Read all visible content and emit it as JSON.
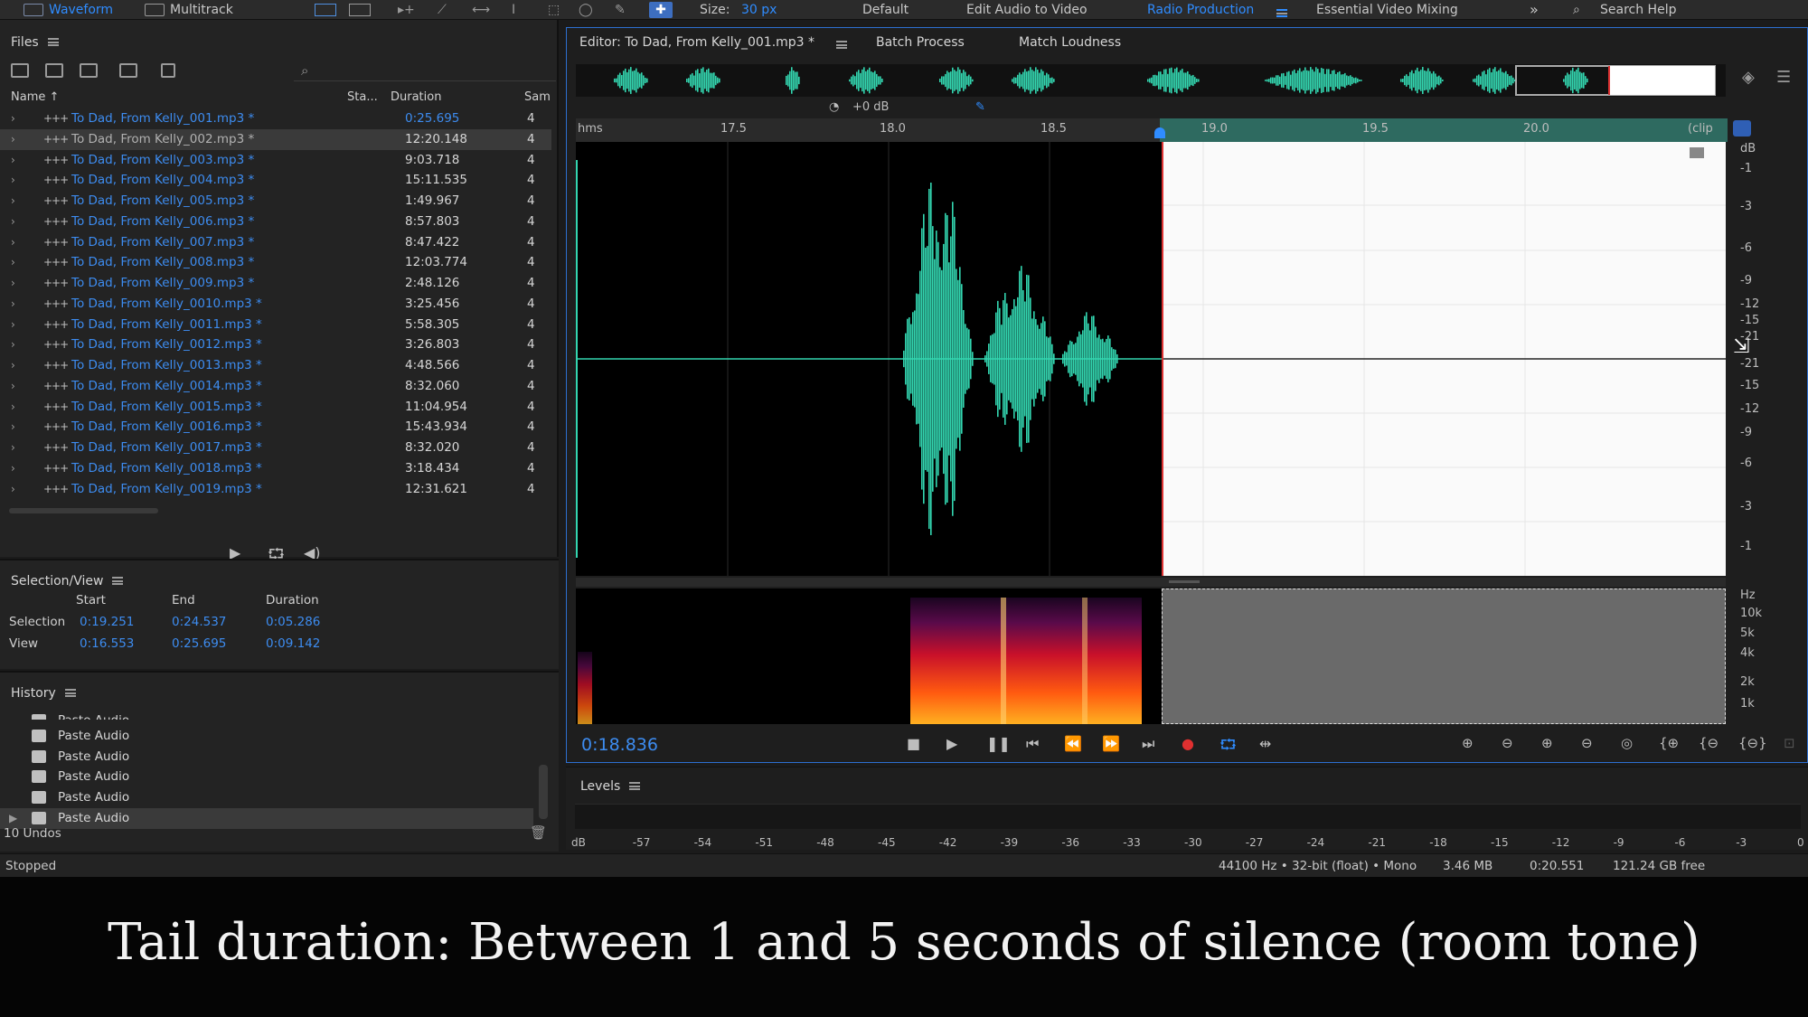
{
  "toolbar": {
    "waveform": "Waveform",
    "multitrack": "Multitrack",
    "size_label": "Size:",
    "size_value": "30 px",
    "workspaces": [
      "Default",
      "Edit Audio to Video",
      "Radio Production",
      "Essential Video Mixing"
    ],
    "more": "»",
    "search_help": "Search Help"
  },
  "files": {
    "title": "Files",
    "columns": {
      "name": "Name ↑",
      "status": "Sta...",
      "duration": "Duration",
      "sample": "Sam"
    },
    "rows": [
      {
        "name": "To Dad, From Kelly_001.mp3 *",
        "duration": "0:25.695",
        "ch": "4"
      },
      {
        "name": "To Dad, From Kelly_002.mp3 *",
        "duration": "12:20.148",
        "ch": "4"
      },
      {
        "name": "To Dad, From Kelly_003.mp3 *",
        "duration": "9:03.718",
        "ch": "4"
      },
      {
        "name": "To Dad, From Kelly_004.mp3 *",
        "duration": "15:11.535",
        "ch": "4"
      },
      {
        "name": "To Dad, From Kelly_005.mp3 *",
        "duration": "1:49.967",
        "ch": "4"
      },
      {
        "name": "To Dad, From Kelly_006.mp3 *",
        "duration": "8:57.803",
        "ch": "4"
      },
      {
        "name": "To Dad, From Kelly_007.mp3 *",
        "duration": "8:47.422",
        "ch": "4"
      },
      {
        "name": "To Dad, From Kelly_008.mp3 *",
        "duration": "12:03.774",
        "ch": "4"
      },
      {
        "name": "To Dad, From Kelly_009.mp3 *",
        "duration": "2:48.126",
        "ch": "4"
      },
      {
        "name": "To Dad, From Kelly_0010.mp3 *",
        "duration": "3:25.456",
        "ch": "4"
      },
      {
        "name": "To Dad, From Kelly_0011.mp3 *",
        "duration": "5:58.305",
        "ch": "4"
      },
      {
        "name": "To Dad, From Kelly_0012.mp3 *",
        "duration": "3:26.803",
        "ch": "4"
      },
      {
        "name": "To Dad, From Kelly_0013.mp3 *",
        "duration": "4:48.566",
        "ch": "4"
      },
      {
        "name": "To Dad, From Kelly_0014.mp3 *",
        "duration": "8:32.060",
        "ch": "4"
      },
      {
        "name": "To Dad, From Kelly_0015.mp3 *",
        "duration": "11:04.954",
        "ch": "4"
      },
      {
        "name": "To Dad, From Kelly_0016.mp3 *",
        "duration": "15:43.934",
        "ch": "4"
      },
      {
        "name": "To Dad, From Kelly_0017.mp3 *",
        "duration": "8:32.020",
        "ch": "4"
      },
      {
        "name": "To Dad, From Kelly_0018.mp3 *",
        "duration": "3:18.434",
        "ch": "4"
      },
      {
        "name": "To Dad, From Kelly_0019.mp3 *",
        "duration": "12:31.621",
        "ch": "4"
      }
    ]
  },
  "selection_view": {
    "title": "Selection/View",
    "start": "Start",
    "end": "End",
    "duration": "Duration",
    "selection_label": "Selection",
    "selection": {
      "start": "0:19.251",
      "end": "0:24.537",
      "duration": "0:05.286"
    },
    "view_label": "View",
    "view": {
      "start": "0:16.553",
      "end": "0:25.695",
      "duration": "0:09.142"
    }
  },
  "history": {
    "title": "History",
    "items": [
      "Paste Audio",
      "Paste Audio",
      "Paste Audio",
      "Paste Audio",
      "Paste Audio",
      "Paste Audio"
    ],
    "undos": "10 Undos"
  },
  "editor": {
    "tab": "Editor: To Dad, From Kelly_001.mp3 *",
    "batch": "Batch Process",
    "match": "Match Loudness",
    "gain": "+0 dB",
    "ruler": {
      "unit": "hms",
      "ticks": [
        "17.5",
        "18.0",
        "18.5",
        "19.0",
        "19.5",
        "20.0"
      ],
      "end": "(clip"
    },
    "db_label": "dB",
    "db_ticks": [
      "-1",
      "-3",
      "-6",
      "-9",
      "-12",
      "-15",
      "-21",
      "-21",
      "-15",
      "-12",
      "-9",
      "-6",
      "-3",
      "-1"
    ],
    "hz_label": "Hz",
    "hz_ticks": [
      "10k",
      "5k",
      "4k",
      "2k",
      "1k"
    ],
    "time": "0:18.836"
  },
  "levels": {
    "title": "Levels",
    "ticks": [
      "dB",
      "-57",
      "-54",
      "-51",
      "-48",
      "-45",
      "-42",
      "-39",
      "-36",
      "-33",
      "-30",
      "-27",
      "-24",
      "-21",
      "-18",
      "-15",
      "-12",
      "-9",
      "-6",
      "-3",
      "0"
    ]
  },
  "status": {
    "state": "Stopped",
    "format": "44100 Hz • 32-bit (float) • Mono",
    "size": "3.46 MB",
    "duration": "0:20.551",
    "free": "121.24 GB free"
  },
  "caption": "Tail duration: Between 1 and 5 seconds of silence (room tone)",
  "colors": {
    "accent": "#2f8cff",
    "wave": "#33d6b0",
    "selection_marker": "#d33333"
  }
}
